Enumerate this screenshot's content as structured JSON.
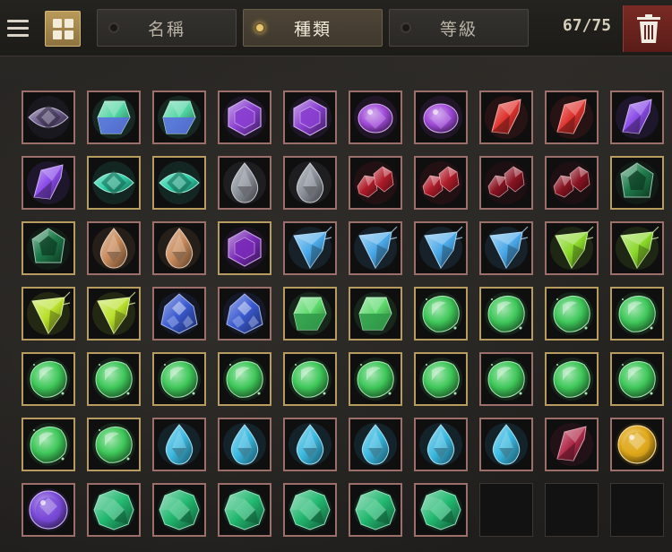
{
  "header": {
    "tabs": [
      {
        "label": "名稱",
        "active": false
      },
      {
        "label": "種類",
        "active": true
      },
      {
        "label": "等級",
        "active": false
      }
    ],
    "count": "67/75"
  },
  "colors": {
    "accent_gold": "#e8c66d",
    "slot_border_common": "#9c6f6a",
    "slot_border_rare": "#b89b5f",
    "trash_red": "#7a2a24"
  },
  "inventory": {
    "columns": 10,
    "rows": [
      [
        {
          "gem": "eye",
          "color": "#6a5a8a",
          "frame": "pink"
        },
        {
          "gem": "prism",
          "color": "#4fd3a0",
          "color2": "#5a6ae0",
          "frame": "pink"
        },
        {
          "gem": "prism",
          "color": "#4fd3a0",
          "color2": "#5a6ae0",
          "frame": "pink"
        },
        {
          "gem": "hex",
          "color": "#8a3fd0",
          "frame": "pink"
        },
        {
          "gem": "hex",
          "color": "#8a3fd0",
          "frame": "pink"
        },
        {
          "gem": "oval",
          "color": "#a04ad8",
          "frame": "pink"
        },
        {
          "gem": "oval",
          "color": "#a04ad8",
          "frame": "pink"
        },
        {
          "gem": "shard",
          "color": "#e0332e",
          "frame": "pink"
        },
        {
          "gem": "shard",
          "color": "#e0332e",
          "frame": "pink"
        },
        {
          "gem": "shard",
          "color": "#8a4ae8",
          "frame": "pink"
        }
      ],
      [
        {
          "gem": "shard",
          "color": "#8a4ae8",
          "frame": "pink"
        },
        {
          "gem": "eye",
          "color": "#2fd0a8",
          "frame": "gold"
        },
        {
          "gem": "eye",
          "color": "#2fd0a8",
          "frame": "gold"
        },
        {
          "gem": "drop",
          "color": "#8a8f98",
          "frame": "pink"
        },
        {
          "gem": "drop",
          "color": "#8a8f98",
          "frame": "pink"
        },
        {
          "gem": "pair",
          "color": "#b01c2a",
          "frame": "pink"
        },
        {
          "gem": "pair",
          "color": "#b01c2a",
          "frame": "pink"
        },
        {
          "gem": "pair",
          "color": "#8a1422",
          "frame": "pink"
        },
        {
          "gem": "pair",
          "color": "#8a1422",
          "frame": "pink"
        },
        {
          "gem": "pentagon",
          "color": "#1e7a4a",
          "frame": "gold"
        }
      ],
      [
        {
          "gem": "pentagon",
          "color": "#1e7a4a",
          "frame": "gold"
        },
        {
          "gem": "drop",
          "color": "#c7895a",
          "frame": "pink"
        },
        {
          "gem": "drop",
          "color": "#c7895a",
          "frame": "pink"
        },
        {
          "gem": "hex",
          "color": "#7a2ab8",
          "frame": "gold"
        },
        {
          "gem": "kite",
          "color": "#4aa8e8",
          "frame": "pink"
        },
        {
          "gem": "kite",
          "color": "#4aa8e8",
          "frame": "pink"
        },
        {
          "gem": "kite",
          "color": "#4aa8e8",
          "frame": "pink"
        },
        {
          "gem": "kite",
          "color": "#4aa8e8",
          "frame": "pink"
        },
        {
          "gem": "kite",
          "color": "#8ad82a",
          "frame": "pink"
        },
        {
          "gem": "kite",
          "color": "#8ad82a",
          "frame": "pink"
        }
      ],
      [
        {
          "gem": "kite",
          "color": "#b8e02a",
          "frame": "gold"
        },
        {
          "gem": "kite",
          "color": "#b8e02a",
          "frame": "gold"
        },
        {
          "gem": "cluster",
          "color": "#3a5ad0",
          "frame": "pink"
        },
        {
          "gem": "cluster",
          "color": "#3a5ad0",
          "frame": "pink"
        },
        {
          "gem": "prism",
          "color": "#5ad86a",
          "color2": "#2f9a4a",
          "frame": "gold"
        },
        {
          "gem": "prism",
          "color": "#5ad86a",
          "color2": "#2f9a4a",
          "frame": "gold"
        },
        {
          "gem": "round",
          "color": "#3fc85a",
          "frame": "gold"
        },
        {
          "gem": "round",
          "color": "#3fc85a",
          "frame": "gold"
        },
        {
          "gem": "round",
          "color": "#3fc85a",
          "frame": "gold"
        },
        {
          "gem": "round",
          "color": "#3fc85a",
          "frame": "gold"
        }
      ],
      [
        {
          "gem": "round",
          "color": "#3fc85a",
          "frame": "gold"
        },
        {
          "gem": "round",
          "color": "#3fc85a",
          "frame": "gold"
        },
        {
          "gem": "round",
          "color": "#3fc85a",
          "frame": "gold"
        },
        {
          "gem": "round",
          "color": "#3fc85a",
          "frame": "gold"
        },
        {
          "gem": "round",
          "color": "#3fc85a",
          "frame": "gold"
        },
        {
          "gem": "round",
          "color": "#3fc85a",
          "frame": "gold"
        },
        {
          "gem": "round",
          "color": "#3fc85a",
          "frame": "gold"
        },
        {
          "gem": "round",
          "color": "#3fc85a",
          "frame": "pink"
        },
        {
          "gem": "round",
          "color": "#3fc85a",
          "frame": "gold"
        },
        {
          "gem": "round",
          "color": "#3fc85a",
          "frame": "gold"
        }
      ],
      [
        {
          "gem": "round",
          "color": "#3fc85a",
          "frame": "gold"
        },
        {
          "gem": "round",
          "color": "#3fc85a",
          "frame": "gold"
        },
        {
          "gem": "drop",
          "color": "#3ab8e0",
          "frame": "pink"
        },
        {
          "gem": "drop",
          "color": "#3ab8e0",
          "frame": "pink"
        },
        {
          "gem": "drop",
          "color": "#3ab8e0",
          "frame": "pink"
        },
        {
          "gem": "drop",
          "color": "#3ab8e0",
          "frame": "pink"
        },
        {
          "gem": "drop",
          "color": "#3ab8e0",
          "frame": "pink"
        },
        {
          "gem": "drop",
          "color": "#3ab8e0",
          "frame": "pink"
        },
        {
          "gem": "shard",
          "color": "#b02a4a",
          "frame": "pink"
        },
        {
          "gem": "orb",
          "color": "#e0a81a",
          "frame": "pink"
        }
      ],
      [
        {
          "gem": "orb",
          "color": "#7a4ad8",
          "frame": "pink"
        },
        {
          "gem": "faceted",
          "color": "#22b870",
          "frame": "pink"
        },
        {
          "gem": "faceted",
          "color": "#22b870",
          "frame": "pink"
        },
        {
          "gem": "faceted",
          "color": "#22b870",
          "frame": "pink"
        },
        {
          "gem": "faceted",
          "color": "#22b870",
          "frame": "pink"
        },
        {
          "gem": "faceted",
          "color": "#22b870",
          "frame": "pink"
        },
        {
          "gem": "faceted",
          "color": "#22b870",
          "frame": "pink"
        },
        {
          "gem": "empty"
        },
        {
          "gem": "empty"
        },
        {
          "gem": "empty"
        }
      ]
    ]
  }
}
